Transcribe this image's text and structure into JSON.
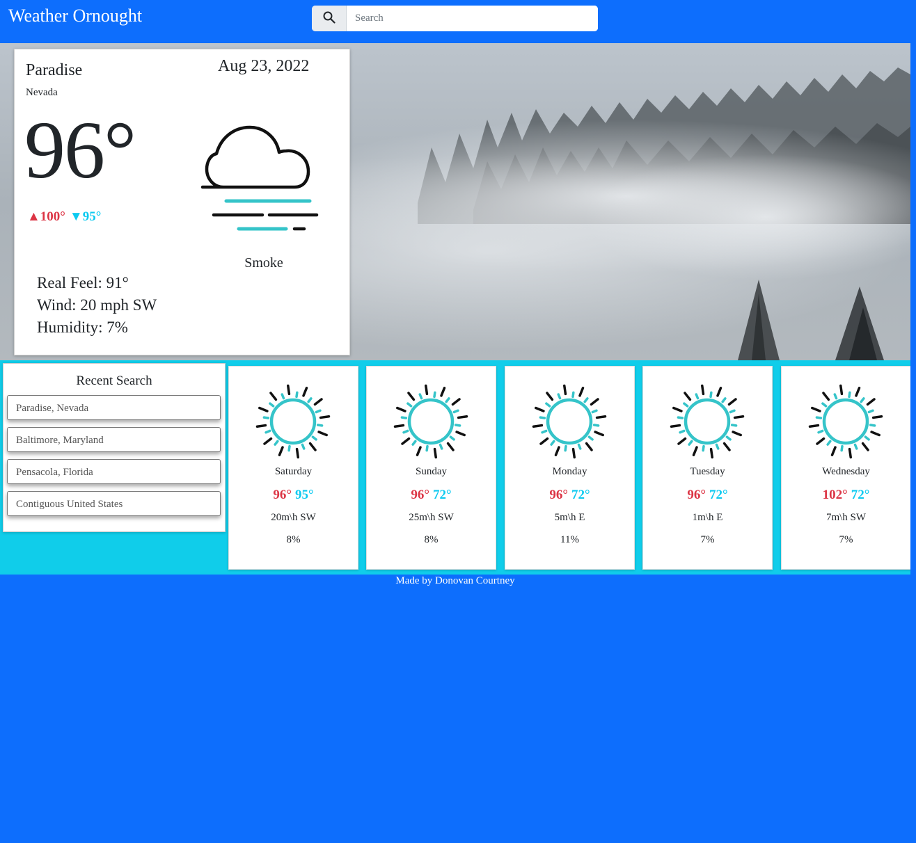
{
  "header": {
    "brand": "Weather Ornought",
    "search_placeholder": "Search",
    "search_value": "",
    "search_icon": "search-icon"
  },
  "current": {
    "city": "Paradise",
    "state": "Nevada",
    "date": "Aug 23, 2022",
    "temp": "96°",
    "high": "▲100°",
    "low": "▼95°",
    "condition": "Smoke",
    "condition_icon": "fog-cloud-icon",
    "real_feel": "Real Feel: 91°",
    "wind": "Wind: 20 mph SW",
    "humidity": "Humidity: 7%"
  },
  "recent": {
    "title": "Recent Search",
    "items": [
      "Paradise, Nevada",
      "Baltimore, Maryland",
      "Pensacola, Florida",
      "Contiguous United States"
    ]
  },
  "forecast": [
    {
      "day": "Saturday",
      "hi": "96°",
      "lo": "95°",
      "wind": "20m\\h SW",
      "humidity": "8%",
      "icon": "sun-icon"
    },
    {
      "day": "Sunday",
      "hi": "96°",
      "lo": "72°",
      "wind": "25m\\h SW",
      "humidity": "8%",
      "icon": "sun-icon"
    },
    {
      "day": "Monday",
      "hi": "96°",
      "lo": "72°",
      "wind": "5m\\h E",
      "humidity": "11%",
      "icon": "sun-icon"
    },
    {
      "day": "Tuesday",
      "hi": "96°",
      "lo": "72°",
      "wind": "1m\\h E",
      "humidity": "7%",
      "icon": "sun-icon"
    },
    {
      "day": "Wednesday",
      "hi": "102°",
      "lo": "72°",
      "wind": "7m\\h SW",
      "humidity": "7%",
      "icon": "sun-icon"
    }
  ],
  "footer": "Made by Donovan Courtney",
  "colors": {
    "navbar": "#0d6efd",
    "strip": "#10cdea",
    "high": "#dc3545",
    "low": "#0dcaf0",
    "icon_accent": "#35c4c9"
  }
}
